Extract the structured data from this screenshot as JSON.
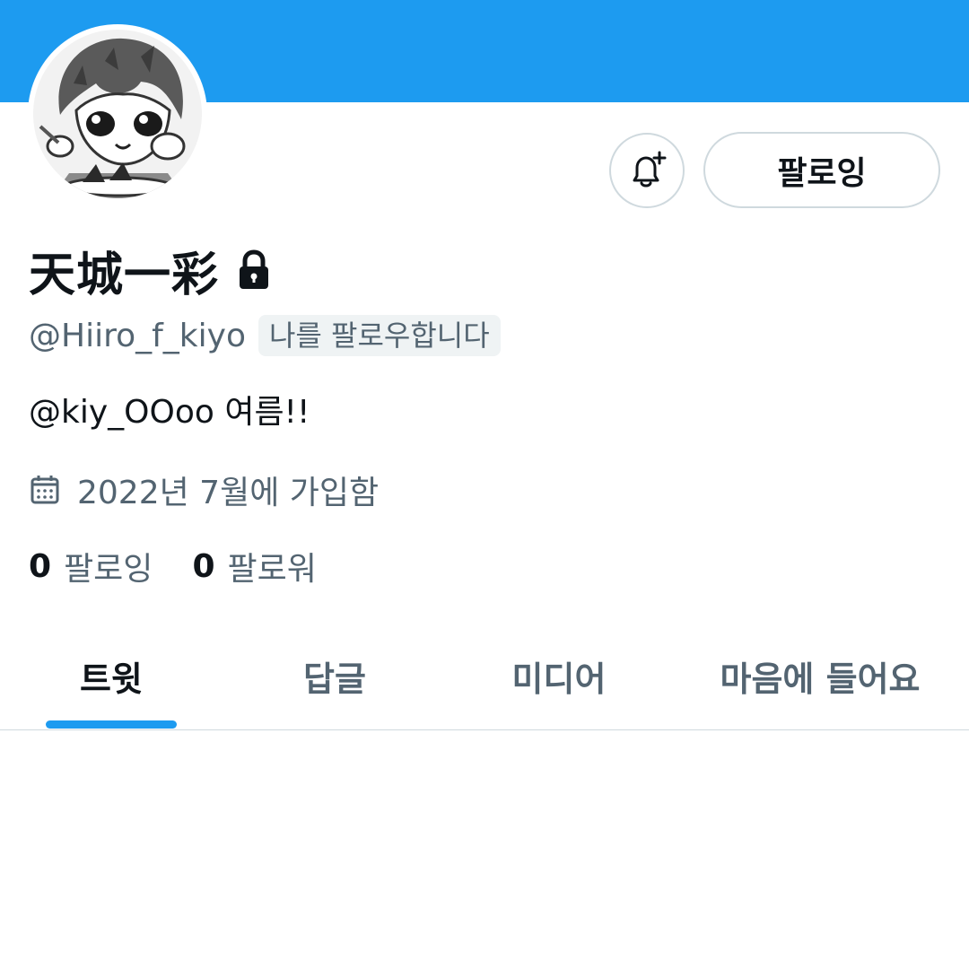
{
  "profile": {
    "display_name": "天城一彩",
    "handle": "@Hiiro_f_kiyo",
    "follows_you_badge": "나를 팔로우합니다",
    "bio": "@kiy_OOoo 여름!!",
    "joined": "2022년 7월에 가입함",
    "protected": true
  },
  "actions": {
    "notify_icon": "bell-plus-icon",
    "follow_label": "팔로잉"
  },
  "stats": {
    "following_count": "0",
    "following_label": "팔로잉",
    "followers_count": "0",
    "followers_label": "팔로워"
  },
  "tabs": [
    {
      "label": "트윗",
      "active": true
    },
    {
      "label": "답글",
      "active": false
    },
    {
      "label": "미디어",
      "active": false
    },
    {
      "label": "마음에 들어요",
      "active": false
    }
  ],
  "colors": {
    "banner": "#1d9bf0",
    "accent": "#1d9bf0",
    "text_primary": "#0f1419",
    "text_secondary": "#536471",
    "border": "#cfd9de"
  }
}
